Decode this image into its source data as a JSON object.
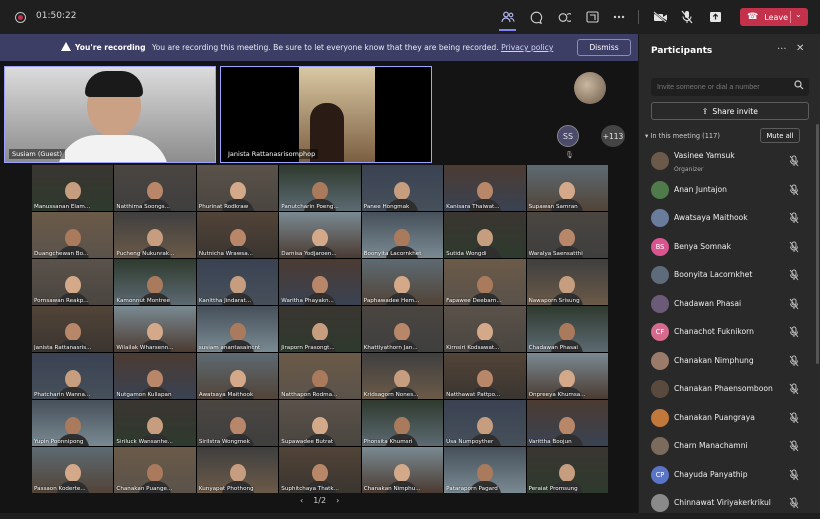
{
  "topbar": {
    "timer": "01:50:22",
    "leave_label": "Leave",
    "icons": [
      "people-icon",
      "chat-icon",
      "reactions-icon",
      "share-screen-icon",
      "more-icon",
      "camera-off-icon",
      "mic-off-icon",
      "share-tray-icon"
    ]
  },
  "banner": {
    "title": "You're recording",
    "message": "You are recording this meeting. Be sure to let everyone know that they are being recorded.",
    "link": "Privacy policy",
    "dismiss_label": "Dismiss"
  },
  "stage": {
    "big_tiles": [
      {
        "name": "Susiam (Guest)"
      },
      {
        "name": "Janista Rattanasrisomphop"
      }
    ],
    "ss_initials": "SS",
    "overflow_count": "+113",
    "page": "1/2",
    "grid": [
      "Manussanan Elam...",
      "Natthima Soongs...",
      "Phurinat Rodkraw",
      "Panutcharin Poeng...",
      "Panee Hongmak",
      "Kanisara Thaiwat...",
      "Supawan Samran",
      "Duangchewan Bo...",
      "Pucheng Nukunrak...",
      "Nutnicha Wrawsa...",
      "Damisa Yodjaroen...",
      "Boonyita Lacornkhet",
      "Sutida Wongdi",
      "Waralya Saensatthi",
      "Pornsawan Reakp...",
      "Kamonnut Montree",
      "Kanittha Jindarat...",
      "Waritha Phayakn...",
      "Paphawadee Hem...",
      "Fapawee Deebarn...",
      "Nawaporn Srisung",
      "Janista Rattanasris...",
      "Wilailak Wharsenn...",
      "susiam anantasaincnt",
      "Jiraporn Prasongt...",
      "Khattiyathorn Jan...",
      "Kirnsiri Kodsawat...",
      "Chadawan Phasai",
      "Phatcharin Wanna...",
      "Nutgamon Kullapan",
      "Awatsaya Maithook",
      "Natthapon Rodma...",
      "Kridsagorn Nones...",
      "Natthawat Pattpo...",
      "Onpreeya Khumsa...",
      "Yupin Poonnipong",
      "Siriluck Wansanhe...",
      "Sirilstra Wongmek",
      "Supawadee Butrat",
      "Phonsita Khumsri",
      "Usa Numpoyther",
      "Varittha Boojun",
      "Passaon Koderte...",
      "Chanakan Puange...",
      "Kunyapat Phothong",
      "Suphitchaya Thatk...",
      "Chanakan Nimphu...",
      "Pataraporn Pagard",
      "Peraiat Promsung"
    ]
  },
  "panel": {
    "title": "Participants",
    "invite_placeholder": "Invite someone or dial a number",
    "share_invite": "Share invite",
    "in_meeting": "In this meeting (117)",
    "mute_all": "Mute all",
    "participants": [
      {
        "name": "Vasinee Yamsuk",
        "role": "Organizer",
        "initials": "",
        "color": "#6b5a4a"
      },
      {
        "name": "Anan Juntajon",
        "role": "",
        "initials": "",
        "color": "#4f7a4a"
      },
      {
        "name": "Awatsaya Maithook",
        "role": "",
        "initials": "",
        "color": "#6a7c9c"
      },
      {
        "name": "Benya Somnak",
        "role": "",
        "initials": "BS",
        "color": "#d9558f"
      },
      {
        "name": "Boonyita Lacornkhet",
        "role": "",
        "initials": "",
        "color": "#5d6b7a"
      },
      {
        "name": "Chadawan Phasai",
        "role": "",
        "initials": "",
        "color": "#6c5b78"
      },
      {
        "name": "Chanachot Fuknikorn",
        "role": "",
        "initials": "CF",
        "color": "#d66a8d"
      },
      {
        "name": "Chanakan Nimphung",
        "role": "",
        "initials": "",
        "color": "#9a7b6a"
      },
      {
        "name": "Chanakan Phaensomboon",
        "role": "",
        "initials": "",
        "color": "#5a4a3e"
      },
      {
        "name": "Chanakan Puangraya",
        "role": "",
        "initials": "",
        "color": "#c1783a"
      },
      {
        "name": "Charn Manachamni",
        "role": "",
        "initials": "",
        "color": "#7b6b5c"
      },
      {
        "name": "Chayuda Panyathip",
        "role": "",
        "initials": "CP",
        "color": "#5a74c8"
      },
      {
        "name": "Chinnawat Viriyakerkrikul",
        "role": "",
        "initials": "",
        "color": "#8a8a8a"
      }
    ]
  }
}
